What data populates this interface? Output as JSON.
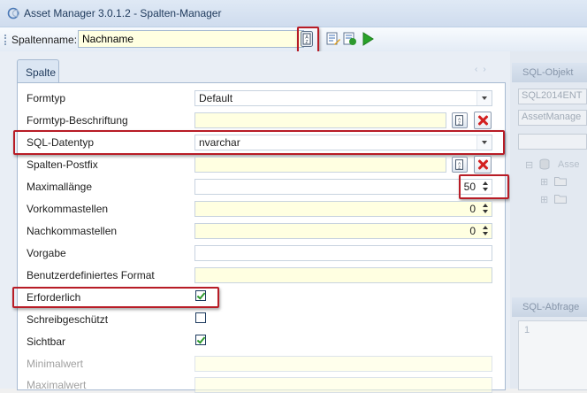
{
  "window": {
    "title": "Asset Manager 3.0.1.2 - Spalten-Manager"
  },
  "toolbar": {
    "label": "Spaltenname:",
    "value": "Nachname"
  },
  "tabs": {
    "active": "Spalte"
  },
  "fields": {
    "formtyp": {
      "label": "Formtyp",
      "value": "Default"
    },
    "formtyp_beschriftung": {
      "label": "Formtyp-Beschriftung",
      "value": ""
    },
    "sql_datentyp": {
      "label": "SQL-Datentyp",
      "value": "nvarchar"
    },
    "spalten_postfix": {
      "label": "Spalten-Postfix",
      "value": ""
    },
    "maximallaenge": {
      "label": "Maximallänge",
      "value": "50"
    },
    "vorkommastellen": {
      "label": "Vorkommastellen",
      "value": "0"
    },
    "nachkommastellen": {
      "label": "Nachkommastellen",
      "value": "0"
    },
    "vorgabe": {
      "label": "Vorgabe",
      "value": ""
    },
    "benutzerdefiniertes_format": {
      "label": "Benutzerdefiniertes Format",
      "value": ""
    },
    "erforderlich": {
      "label": "Erforderlich",
      "checked": true
    },
    "schreibgeschuetzt": {
      "label": "Schreibgeschützt",
      "checked": false
    },
    "sichtbar": {
      "label": "Sichtbar",
      "checked": true
    },
    "minimalwert": {
      "label": "Minimalwert"
    },
    "maximalwert": {
      "label": "Maximalwert"
    }
  },
  "right_pane": {
    "header_top": "SQL-Objekt",
    "box1": "SQL2014ENT",
    "box2": "AssetManage",
    "tree_item": "Asse",
    "header_bottom": "SQL-Abfrage",
    "line_number": "1"
  },
  "colors": {
    "highlight_red": "#b81c26",
    "field_yellow": "#ffffe1",
    "check_green": "#2e9a2e"
  }
}
